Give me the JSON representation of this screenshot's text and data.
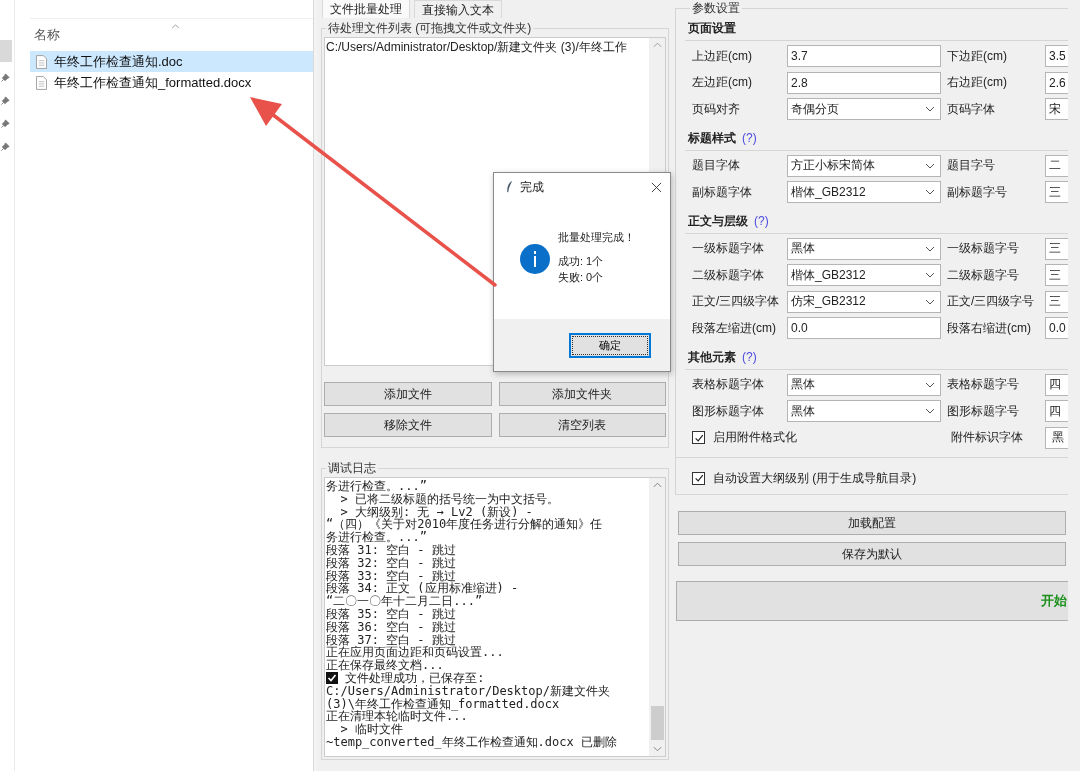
{
  "explorer": {
    "column_header": "名称",
    "files": [
      {
        "name": "年终工作检查通知.doc",
        "selected": true
      },
      {
        "name": "年终工作检查通知_formatted.docx",
        "selected": false
      }
    ]
  },
  "tabs": [
    {
      "label": "文件批量处理",
      "selected": true
    },
    {
      "label": "直接输入文本",
      "selected": false
    }
  ],
  "file_list": {
    "title": "待处理文件列表 (可拖拽文件或文件夹)",
    "items": [
      "C:/Users/Administrator/Desktop/新建文件夹 (3)/年终工作"
    ]
  },
  "file_buttons": [
    "添加文件",
    "添加文件夹",
    "移除文件",
    "清空列表"
  ],
  "log": {
    "title": "调试日志",
    "lines": [
      {
        "kind": "text",
        "text": "务进行检查。...”"
      },
      {
        "kind": "text",
        "text": "  > 已将二级标题的括号统一为中文括号。"
      },
      {
        "kind": "text",
        "text": "  > 大纲级别: 无 → Lv2 (新设) -"
      },
      {
        "kind": "text",
        "text": "“（四）《关于对2010年度任务进行分解的通知》任"
      },
      {
        "kind": "text",
        "text": "务进行检查。...”"
      },
      {
        "kind": "text",
        "text": "段落 31: 空白 - 跳过"
      },
      {
        "kind": "text",
        "text": "段落 32: 空白 - 跳过"
      },
      {
        "kind": "text",
        "text": "段落 33: 空白 - 跳过"
      },
      {
        "kind": "text",
        "text": "段落 34: 正文 (应用标准缩进) -"
      },
      {
        "kind": "text",
        "text": "“二〇一〇年十二月二日...”"
      },
      {
        "kind": "text",
        "text": "段落 35: 空白 - 跳过"
      },
      {
        "kind": "text",
        "text": "段落 36: 空白 - 跳过"
      },
      {
        "kind": "text",
        "text": "段落 37: 空白 - 跳过"
      },
      {
        "kind": "text",
        "text": "正在应用页面边距和页码设置..."
      },
      {
        "kind": "text",
        "text": "正在保存最终文档..."
      },
      {
        "kind": "success",
        "text": "文件处理成功，已保存至:"
      },
      {
        "kind": "text",
        "text": "C:/Users/Administrator/Desktop/新建文件夹"
      },
      {
        "kind": "text",
        "text": "(3)\\年终工作检查通知_formatted.docx"
      },
      {
        "kind": "text",
        "text": "正在清理本轮临时文件..."
      },
      {
        "kind": "text",
        "text": "  > 临时文件"
      },
      {
        "kind": "text",
        "text": "~temp_converted_年终工作检查通知.docx 已删除"
      }
    ]
  },
  "dialog": {
    "title": "完成",
    "message": "批量处理完成！",
    "details": [
      "成功: 1个",
      "失败: 0个"
    ],
    "button": "确定"
  },
  "settings": {
    "title": "参数设置",
    "sections": [
      {
        "title": "页面设置",
        "rows": [
          [
            {
              "kind": "input",
              "label": "上边距(cm)",
              "value": "3.7"
            },
            {
              "kind": "input",
              "label": "下边距(cm)",
              "value": "3.5"
            }
          ],
          [
            {
              "kind": "input",
              "label": "左边距(cm)",
              "value": "2.8"
            },
            {
              "kind": "input",
              "label": "右边距(cm)",
              "value": "2.6"
            }
          ],
          [
            {
              "kind": "select",
              "label": "页码对齐",
              "value": "奇偶分页"
            },
            {
              "kind": "select",
              "label": "页码字体",
              "value": "宋"
            }
          ]
        ]
      },
      {
        "title": "标题样式",
        "help": "(?)",
        "rows": [
          [
            {
              "kind": "select",
              "label": "题目字体",
              "value": "方正小标宋简体"
            },
            {
              "kind": "select",
              "label": "题目字号",
              "value": "二"
            }
          ],
          [
            {
              "kind": "select",
              "label": "副标题字体",
              "value": "楷体_GB2312"
            },
            {
              "kind": "select",
              "label": "副标题字号",
              "value": "三"
            }
          ]
        ]
      },
      {
        "title": "正文与层级",
        "help": "(?)",
        "rows": [
          [
            {
              "kind": "select",
              "label": "一级标题字体",
              "value": "黑体"
            },
            {
              "kind": "select",
              "label": "一级标题字号",
              "value": "三"
            }
          ],
          [
            {
              "kind": "select",
              "label": "二级标题字体",
              "value": "楷体_GB2312"
            },
            {
              "kind": "select",
              "label": "二级标题字号",
              "value": "三"
            }
          ],
          [
            {
              "kind": "select",
              "label": "正文/三四级字体",
              "value": "仿宋_GB2312"
            },
            {
              "kind": "select",
              "label": "正文/三四级字号",
              "value": "三"
            }
          ],
          [
            {
              "kind": "input",
              "label": "段落左缩进(cm)",
              "value": "0.0"
            },
            {
              "kind": "input",
              "label": "段落右缩进(cm)",
              "value": "0.0"
            }
          ]
        ]
      },
      {
        "title": "其他元素",
        "help": "(?)",
        "rows": [
          [
            {
              "kind": "select",
              "label": "表格标题字体",
              "value": "黑体"
            },
            {
              "kind": "select",
              "label": "表格标题字号",
              "value": "四"
            }
          ],
          [
            {
              "kind": "select",
              "label": "图形标题字体",
              "value": "黑体"
            },
            {
              "kind": "select",
              "label": "图形标题字号",
              "value": "四"
            }
          ],
          [
            {
              "kind": "checkbox",
              "label": "启用附件格式化",
              "checked": true
            },
            {
              "kind": "select",
              "label": "附件标识字体",
              "value": "黑"
            }
          ]
        ]
      }
    ],
    "outline_option": {
      "label": "自动设置大纲级别 (用于生成导航目录)",
      "checked": true
    }
  },
  "config_buttons": [
    "加载配置",
    "保存为默认"
  ],
  "start_button": "开始"
}
